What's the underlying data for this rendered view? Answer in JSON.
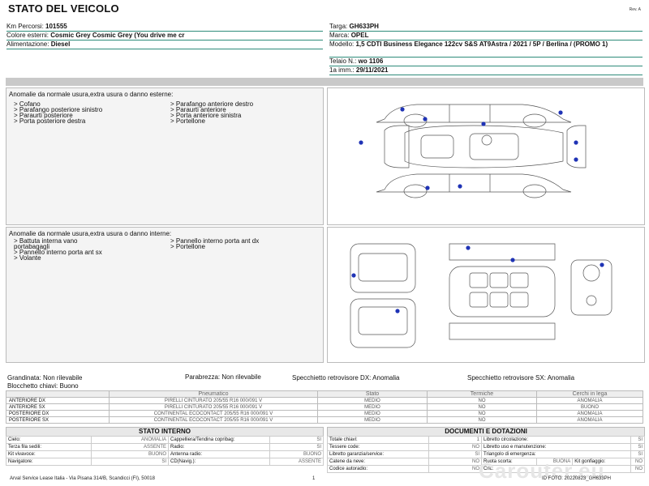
{
  "header": {
    "title": "STATO DEL VEICOLO",
    "rev": "Rev. A"
  },
  "left_info": [
    {
      "label": "Km Percorsi:",
      "value": "101555"
    },
    {
      "label": "Colore esterni:",
      "value": "Cosmic Grey Cosmic Grey (You drive me cr"
    },
    {
      "label": "Alimentazione:",
      "value": "Diesel"
    }
  ],
  "right_info": {
    "targa": {
      "label": "Targa:",
      "value": "GH633PH"
    },
    "marca": {
      "label": "Marca:",
      "value": "OPEL"
    },
    "modello": {
      "label": "Modello:",
      "value": "1,5 CDTI Business Elegance 122cv S&S AT9Astra / 2021 / 5P / Berlina / (PROMO 1)"
    },
    "telaio": {
      "label": "Telaio N.:",
      "value": "wo 1106"
    },
    "imm": {
      "label": "1a imm.:",
      "value": "29/11/2021"
    }
  },
  "external": {
    "title": "Anomalie da normale usura,extra usura o danno esterne:",
    "col1": [
      "> Cofano",
      "> Parafango posteriore sinistro",
      "> Paraurti posteriore",
      "> Porta posteriore destra"
    ],
    "col2": [
      "> Parafango anteriore destro",
      "> Paraurti anteriore",
      "> Porta anteriore sinistra",
      "> Portellone"
    ]
  },
  "internal": {
    "title": "Anomalie da normale usura,extra usura o danno interne:",
    "col1": [
      "> Battuta interna vano",
      "portabagagli",
      "> Pannello interno porta ant sx",
      "> Volante"
    ],
    "col2": [
      "> Pannello interno porta ant dx",
      "> Portellone"
    ]
  },
  "status": {
    "grandinata": "Grandinata: Non rilevabile",
    "parabrezza": "Parabrezza: Non rilevabile",
    "spec_dx": "Specchietto retrovisore DX: Anomalia",
    "spec_sx": "Specchietto retrovisore SX: Anomalia",
    "blocchetto": "Blocchetto chiavi: Buono"
  },
  "tyres": {
    "headers": [
      "",
      "Pneumatico",
      "Stato",
      "Termiche",
      "Cerchi in lega"
    ],
    "rows": [
      [
        "ANTERIORE DX",
        "PIRELLI  CINTURATO  205/55 R16 000/091 V",
        "MEDIO",
        "NO",
        "ANOMALIA"
      ],
      [
        "ANTERIORE SX",
        "PIRELLI  CINTURATO  205/55 R16 000/091 V",
        "MEDIO",
        "NO",
        "BUONO"
      ],
      [
        "POSTERIORE DX",
        "CONTINENTAL ECOCONTACT  205/55 R16 000/091 V",
        "MEDIO",
        "NO",
        "ANOMALIA"
      ],
      [
        "POSTERIORE SX",
        "CONTINENTAL ECOCONTACT  205/55 R16 000/091 V",
        "MEDIO",
        "NO",
        "ANOMALIA"
      ]
    ]
  },
  "interior": {
    "title": "STATO INTERNO",
    "rows": [
      [
        "Cielo:",
        "ANOMALIA",
        "Cappelliera/Tendina copribag:",
        "SI"
      ],
      [
        "Terza fila sedili:",
        "ASSENTE",
        "Radio:",
        "SI"
      ],
      [
        "Kit vivavoce:",
        "BUONO",
        "Antenna radio:",
        "BUONO"
      ],
      [
        "Navigatore:",
        "SI",
        "CD(Navig.):",
        "ASSENTE"
      ]
    ]
  },
  "documents": {
    "title": "DOCUMENTI E DOTAZIONI",
    "rows": [
      [
        "Totale chiavi:",
        "1",
        "Libretto circolazione:",
        "SI"
      ],
      [
        "Tessere code:",
        "NO",
        "Libretto uso e manutenzione:",
        "SI"
      ],
      [
        "Libretto garanzia/service:",
        "SI",
        "Triangolo di emergenza:",
        "SI"
      ],
      [
        "Catene da neve:",
        "NO",
        "Ruota scorta:",
        "BUONA",
        "Kit gonfiaggio:",
        "NO"
      ],
      [
        "Codice autoradio:",
        "NO",
        "Cric:",
        "NO"
      ]
    ]
  },
  "footer": {
    "company": "Arval Service Lease Italia - Via Pisana 314/B, Scandicci (FI), 50018",
    "page": "1",
    "id": "ID FOTO: 20220823_GH633PH"
  },
  "watermark": "Carouter.eu",
  "colors": {
    "rule": "#2e8b7a",
    "dot": "#1f33b5",
    "band": "#c9c9c9"
  },
  "icons": {
    "damage_marker": "blue-dot"
  }
}
